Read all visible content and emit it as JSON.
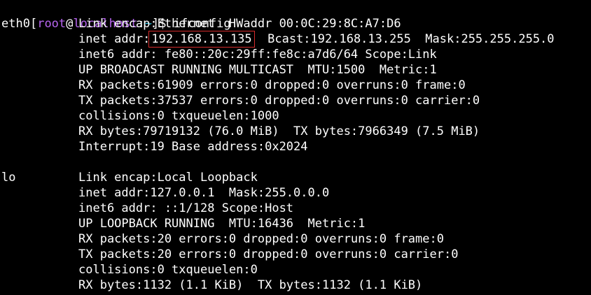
{
  "terminal": {
    "prompt": {
      "open_bracket": "[",
      "user": "root",
      "at": "@",
      "host": "localhost",
      "colon": ":",
      "path": "~",
      "close": "]$",
      "command": " ifconfig"
    },
    "interfaces": [
      {
        "name": "eth0",
        "lines": [
          "Link encap:Ethernet  HWaddr 00:0C:29:8C:A7:D6",
          "inet6 addr: fe80::20c:29ff:fe8c:a7d6/64 Scope:Link",
          "UP BROADCAST RUNNING MULTICAST  MTU:1500  Metric:1",
          "RX packets:61909 errors:0 dropped:0 overruns:0 frame:0",
          "TX packets:37537 errors:0 dropped:0 overruns:0 carrier:0",
          "collisions:0 txqueuelen:1000",
          "RX bytes:79719132 (76.0 MiB)  TX bytes:7966349 (7.5 MiB)",
          "Interrupt:19 Base address:0x2024"
        ],
        "inet_prefix": "inet addr:",
        "inet_addr": "192.168.13.135",
        "inet_suffix": "  Bcast:192.168.13.255  Mask:255.255.255.0"
      },
      {
        "name": "lo",
        "lines": [
          "Link encap:Local Loopback",
          "inet addr:127.0.0.1  Mask:255.0.0.0",
          "inet6 addr: ::1/128 Scope:Host",
          "UP LOOPBACK RUNNING  MTU:16436  Metric:1",
          "RX packets:20 errors:0 dropped:0 overruns:0 frame:0",
          "TX packets:20 errors:0 dropped:0 overruns:0 carrier:0",
          "collisions:0 txqueuelen:0",
          "RX bytes:1132 (1.1 KiB)  TX bytes:1132 (1.1 KiB)"
        ]
      }
    ],
    "colors": {
      "background": "#000000",
      "text": "#ffffff",
      "user": "#b765f0",
      "host": "#b765f0",
      "path": "#35c8e8",
      "highlight_box": "#d62b2b"
    }
  }
}
